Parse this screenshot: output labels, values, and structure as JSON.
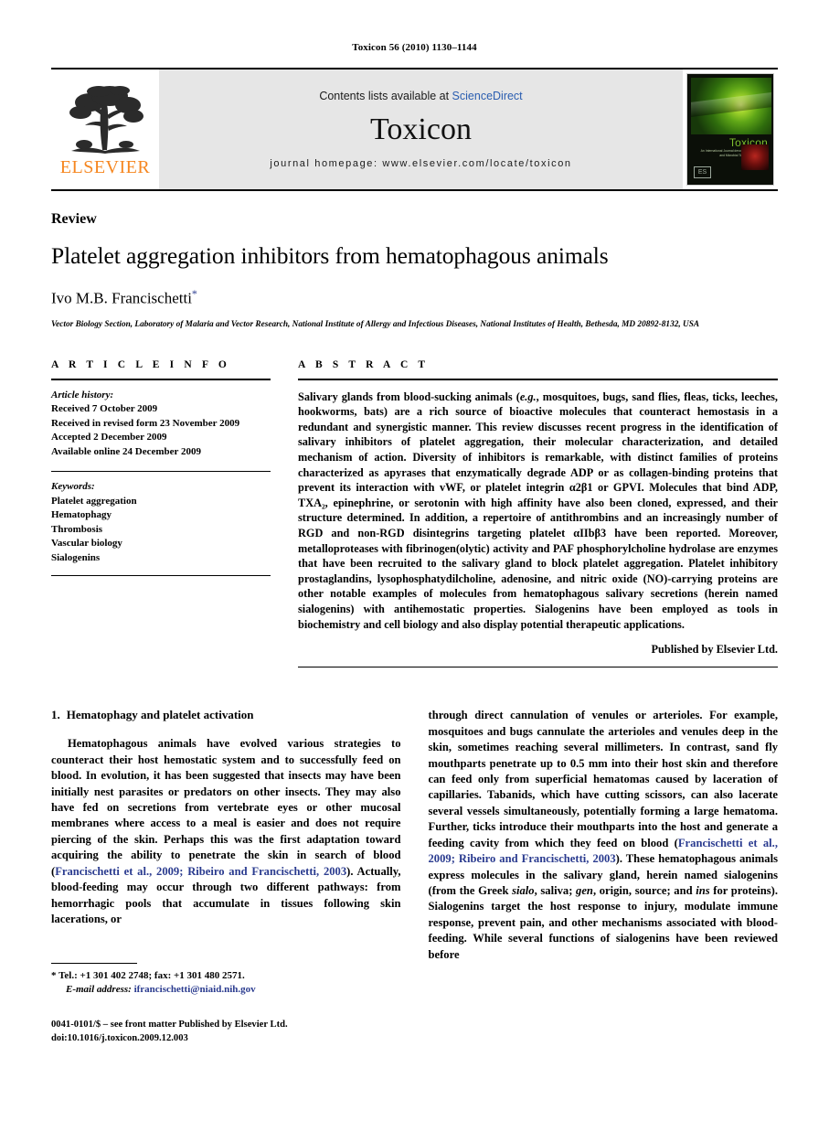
{
  "running_head": "Toxicon 56 (2010) 1130–1144",
  "masthead": {
    "publisher_name": "ELSEVIER",
    "contents_prefix": "Contents lists available at ",
    "contents_link": "ScienceDirect",
    "journal_name": "Toxicon",
    "homepage": "journal homepage: www.elsevier.com/locate/toxicon",
    "cover": {
      "title": "Toxicon",
      "subtitle": "An International Journal devoted to Animal, Plant and Microbial Toxins and Antitoxins",
      "logo_text": "ES"
    }
  },
  "article": {
    "doc_type": "Review",
    "title": "Platelet aggregation inhibitors from hematophagous animals",
    "author": "Ivo M.B. Francischetti",
    "author_marker": "*",
    "affiliation": "Vector Biology Section, Laboratory of Malaria and Vector Research, National Institute of Allergy and Infectious Diseases, National Institutes of Health, Bethesda, MD 20892-8132, USA"
  },
  "article_info": {
    "heading": "A R T I C L E   I N F O",
    "history_label": "Article history:",
    "history": [
      "Received 7 October 2009",
      "Received in revised form 23 November 2009",
      "Accepted 2 December 2009",
      "Available online 24 December 2009"
    ],
    "keywords_label": "Keywords:",
    "keywords": [
      "Platelet aggregation",
      "Hematophagy",
      "Thrombosis",
      "Vascular biology",
      "Sialogenins"
    ]
  },
  "abstract": {
    "heading": "A B S T R A C T",
    "paragraph_1": "Salivary glands from blood-sucking animals (",
    "eg_italic": "e.g.",
    "paragraph_2": ", mosquitoes, bugs, sand flies, fleas, ticks, leeches, hookworms, bats) are a rich source of bioactive molecules that counteract hemostasis in a redundant and synergistic manner. This review discusses recent progress in the identification of salivary inhibitors of platelet aggregation, their molecular characterization, and detailed mechanism of action. Diversity of inhibitors is remarkable, with distinct families of proteins characterized as apyrases that enzymatically degrade ADP or as collagen-binding proteins that prevent its interaction with vWF, or platelet integrin α2β1 or GPVI. Molecules that bind ADP, TXA₂, epinephrine, or serotonin with high affinity have also been cloned, expressed, and their structure determined. In addition, a repertoire of antithrombins and an increasingly number of RGD and non-RGD disintegrins targeting platelet αIIbβ3 have been reported. Moreover, metalloproteases with fibrinogen(olytic) activity and PAF phosphorylcholine hydrolase are enzymes that have been recruited to the salivary gland to block platelet aggregation. Platelet inhibitory prostaglandins, lysophosphatydilcholine, adenosine, and nitric oxide (NO)-carrying proteins are other notable examples of molecules from hematophagous salivary secretions (herein named sialogenins) with antihemostatic properties. Sialogenins have been employed as tools in biochemistry and cell biology and also display potential therapeutic applications.",
    "published_by": "Published by Elsevier Ltd."
  },
  "body": {
    "section_number": "1.",
    "section_title": "Hematophagy and platelet activation",
    "left_col": {
      "part_1": "Hematophagous animals have evolved various strategies to counteract their host hemostatic system and to successfully feed on blood. In evolution, it has been suggested that insects may have been initially nest parasites or predators on other insects. They may also have fed on secretions from vertebrate eyes or other mucosal membranes where access to a meal is easier and does not require piercing of the skin. Perhaps this was the first adaptation toward acquiring the ability to penetrate the skin in search of blood (",
      "citation_1": "Francischetti et al., 2009; Ribeiro and Francischetti, 2003",
      "part_2": "). Actually, blood-feeding may occur through two different pathways: from hemorrhagic pools that accumulate in tissues following skin lacerations, or"
    },
    "right_col": {
      "part_1": "through direct cannulation of venules or arterioles. For example, mosquitoes and bugs cannulate the arterioles and venules deep in the skin, sometimes reaching several millimeters. In contrast, sand fly mouthparts penetrate up to 0.5 mm into their host skin and therefore can feed only from superficial hematomas caused by laceration of capillaries. Tabanids, which have cutting scissors, can also lacerate several vessels simultaneously, potentially forming a large hematoma. Further, ticks introduce their mouthparts into the host and generate a feeding cavity from which they feed on blood (",
      "citation_1": "Francischetti et al., 2009; Ribeiro and Francischetti, 2003",
      "part_2": "). These hematophagous animals express molecules in the salivary gland, herein named sialogenins (from the Greek ",
      "greek_1": "sialo",
      "part_3": ", saliva; ",
      "greek_2": "gen",
      "part_4": ", origin, source; and ",
      "greek_3": "ins",
      "part_5": " for proteins). Sialogenins target the host response to injury, modulate immune response, prevent pain, and other mechanisms associated with blood-feeding. While several functions of sialogenins have been reviewed before"
    }
  },
  "footnote": {
    "marker": "*",
    "contact": "Tel.: +1 301 402 2748; fax: +1 301 480 2571.",
    "email_label": "E-mail address:",
    "email": "ifrancischetti@niaid.nih.gov"
  },
  "page_footer": {
    "line_1": "0041-0101/$ – see front matter Published by Elsevier Ltd.",
    "line_2": "doi:10.1016/j.toxicon.2009.12.003"
  }
}
